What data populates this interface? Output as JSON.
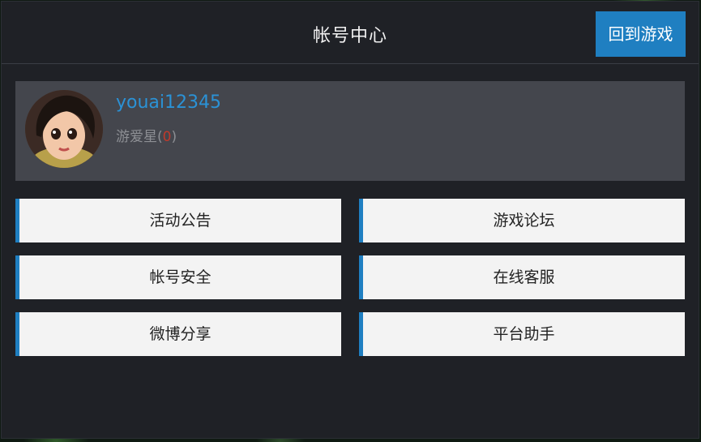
{
  "header": {
    "title": "帐号中心",
    "back_button": "回到游戏"
  },
  "profile": {
    "username": "youai12345",
    "star_label": "游爱星",
    "star_open": "(",
    "star_count": "0",
    "star_close": ")",
    "avatar_icon": "user-avatar-icon"
  },
  "menu": [
    {
      "label": "活动公告"
    },
    {
      "label": "游戏论坛"
    },
    {
      "label": "帐号安全"
    },
    {
      "label": "在线客服"
    },
    {
      "label": "微博分享"
    },
    {
      "label": "平台助手"
    }
  ],
  "colors": {
    "accent": "#1f7fc1",
    "panel_bg": "#1f2126",
    "profile_bg": "#44464d",
    "button_bg": "#f3f3f3"
  }
}
